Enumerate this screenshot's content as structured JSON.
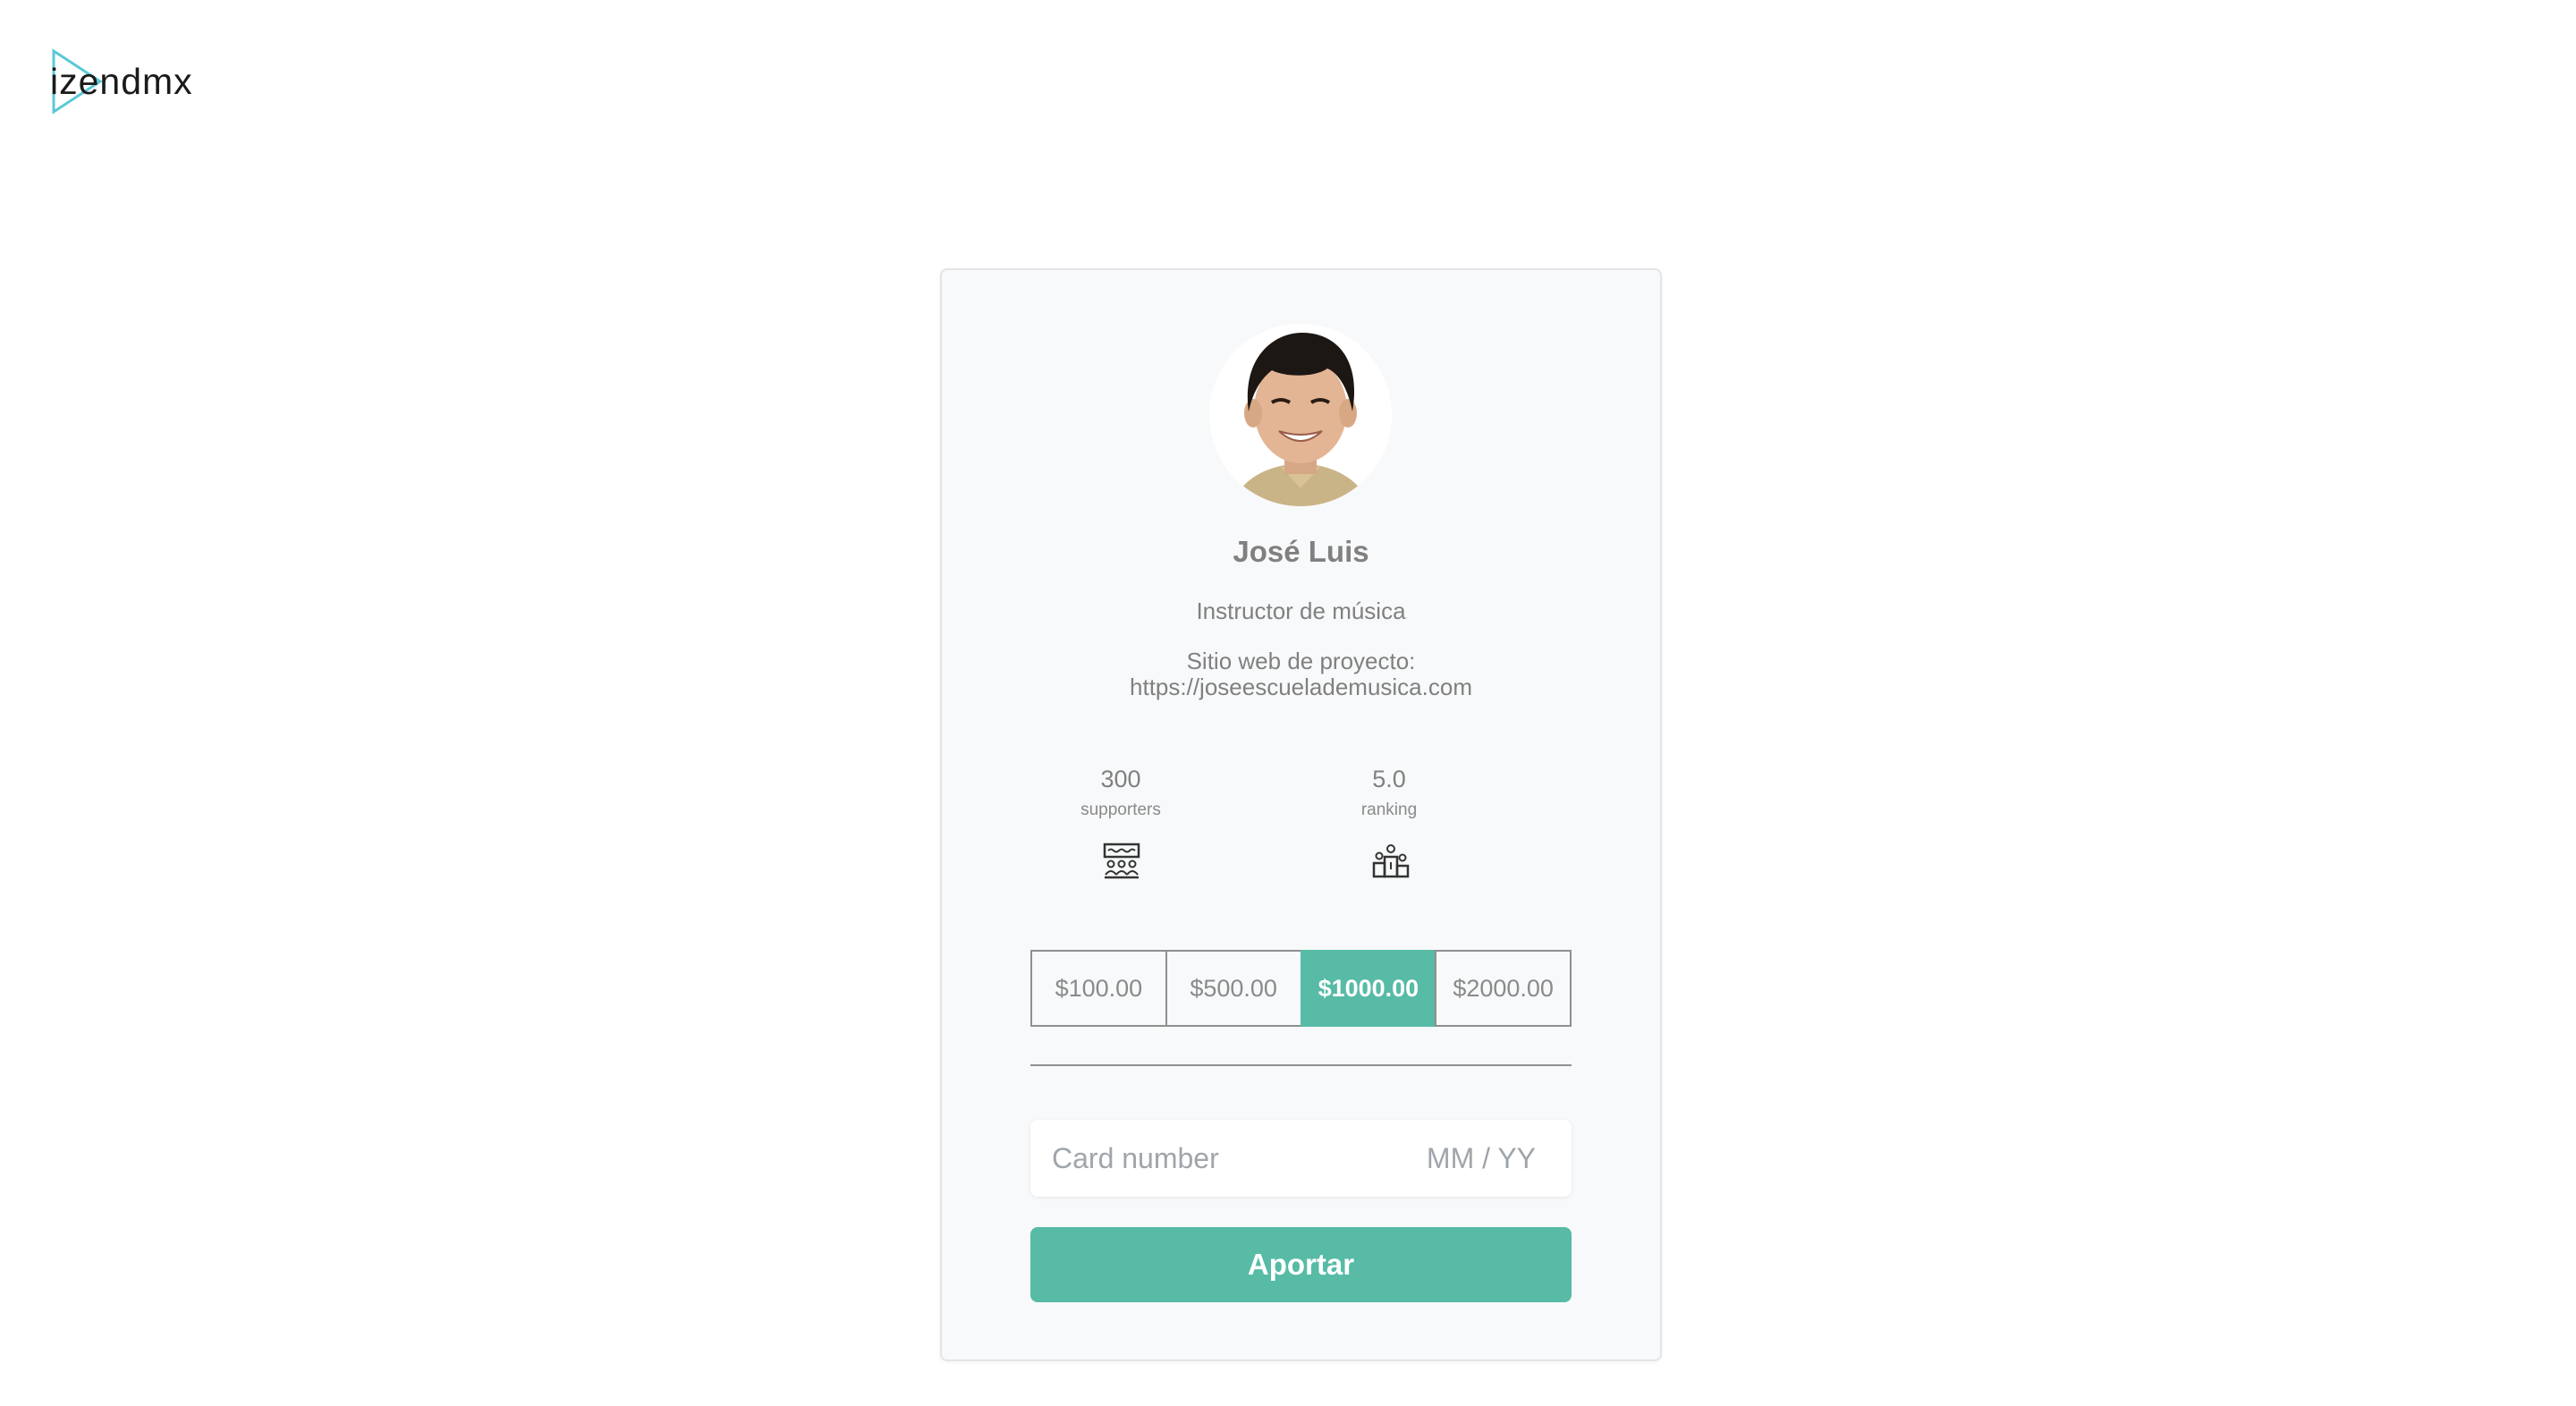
{
  "header": {
    "logo_text": "izendmx"
  },
  "profile": {
    "name": "José Luis",
    "role": "Instructor de música",
    "site_label": "Sitio web de proyecto:",
    "site_url": "https://joseescuelademusica.com"
  },
  "stats": [
    {
      "value": "300",
      "label": "supporters",
      "icon": "supporters-icon"
    },
    {
      "value": "5.0",
      "label": "ranking",
      "icon": "podium-icon"
    }
  ],
  "amounts": [
    "$100.00",
    "$500.00",
    "$1000.00",
    "$2000.00"
  ],
  "selected_amount": "$1000.00",
  "payment": {
    "card_placeholder": "Card number",
    "expiry_placeholder": "MM / YY",
    "submit_label": "Aportar"
  },
  "colors": {
    "accent": "#57bba6",
    "logo_triangle": "#5bc8d8"
  }
}
